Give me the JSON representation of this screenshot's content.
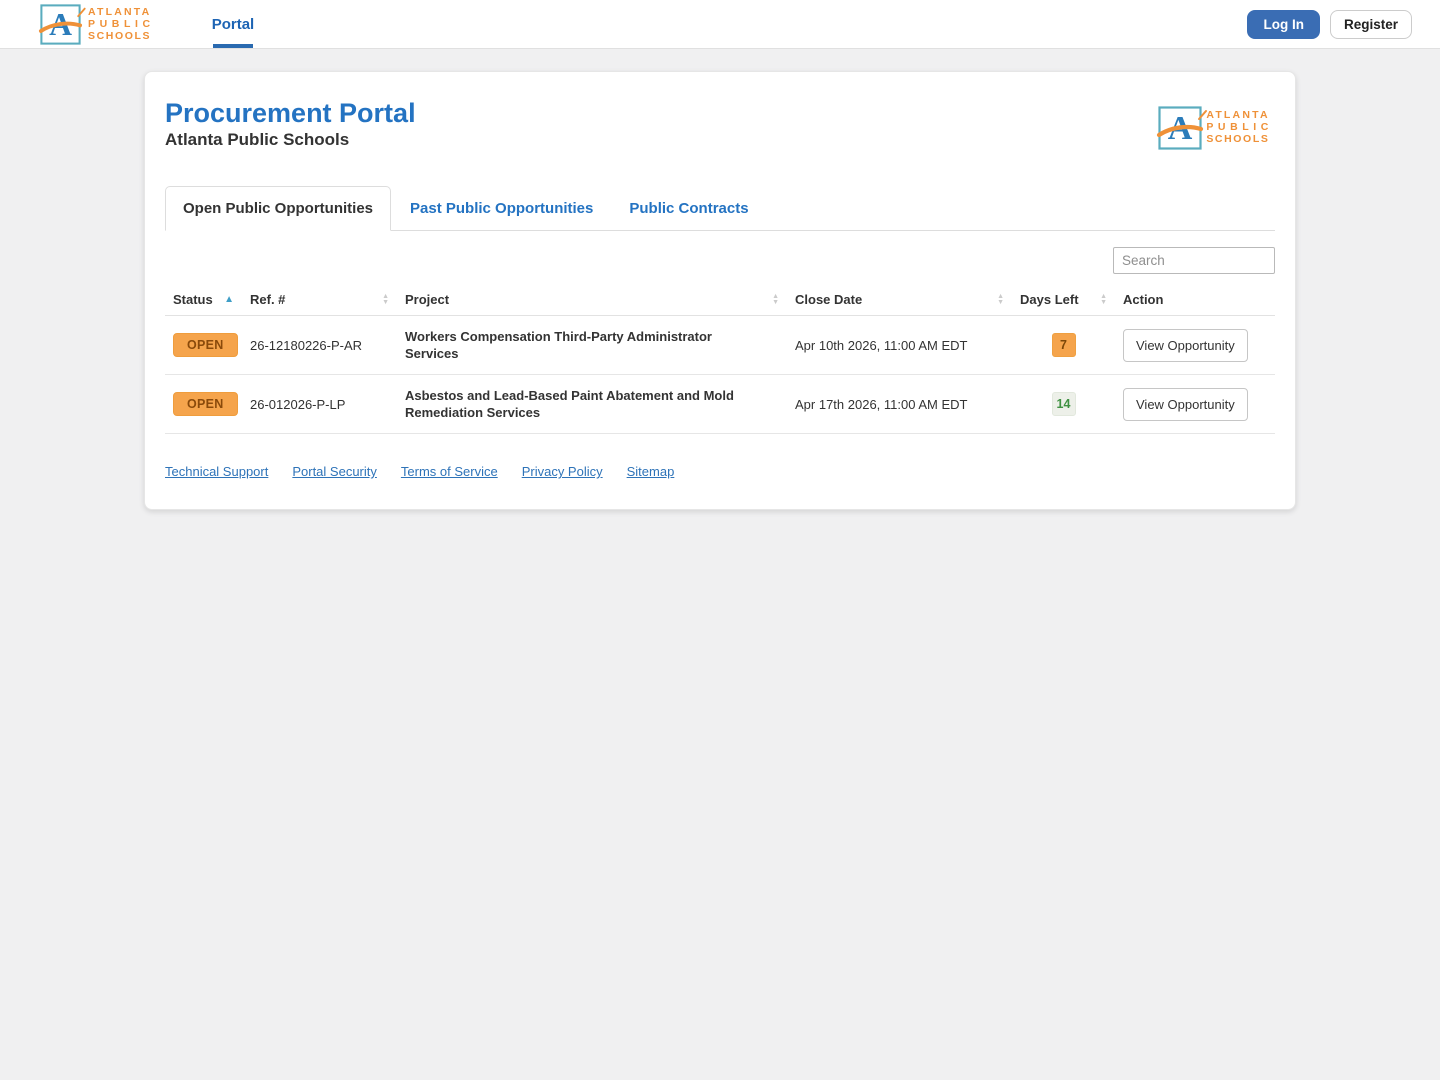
{
  "brand": {
    "letter": "A",
    "line1": "ATLANTA",
    "line2": "PUBLIC",
    "line3": "SCHOOLS"
  },
  "navbar": {
    "portal_link": "Portal",
    "login_label": "Log In",
    "register_label": "Register"
  },
  "header": {
    "title": "Procurement Portal",
    "subtitle": "Atlanta Public Schools"
  },
  "tabs": [
    {
      "label": "Open Public Opportunities",
      "active": true
    },
    {
      "label": "Past Public Opportunities",
      "active": false
    },
    {
      "label": "Public Contracts",
      "active": false
    }
  ],
  "search": {
    "placeholder": "Search"
  },
  "table": {
    "columns": [
      {
        "label": "Status",
        "sort": "asc"
      },
      {
        "label": "Ref. #",
        "sort": "both"
      },
      {
        "label": "Project",
        "sort": "both"
      },
      {
        "label": "Close Date",
        "sort": "both"
      },
      {
        "label": "Days Left",
        "sort": "both"
      },
      {
        "label": "Action",
        "sort": "none"
      }
    ],
    "rows": [
      {
        "status": "OPEN",
        "ref": "26-12180226-P-AR",
        "project": "Workers Compensation Third-Party Administrator Services",
        "close_date": "Apr 10th 2026, 11:00 AM EDT",
        "days_left": "7",
        "days_left_style": "orange",
        "action": "View Opportunity"
      },
      {
        "status": "OPEN",
        "ref": "26-012026-P-LP",
        "project": "Asbestos and Lead-Based Paint Abatement and Mold Remediation Services",
        "close_date": "Apr 17th 2026, 11:00 AM EDT",
        "days_left": "14",
        "days_left_style": "green",
        "action": "View Opportunity"
      }
    ]
  },
  "footer": {
    "links": [
      "Technical Support",
      "Portal Security",
      "Terms of Service",
      "Privacy Policy",
      "Sitemap"
    ]
  },
  "colors": {
    "accent_blue": "#2473c2",
    "button_blue": "#3a6db4",
    "badge_orange_bg": "#f5a44c",
    "badge_orange_text": "#8a4a0b",
    "badge_green_bg": "#edf0e9",
    "badge_green_text": "#3f9142",
    "brand_orange": "#ef9138",
    "brand_teal": "#5aacbe",
    "brand_letter_blue": "#2b7cba"
  }
}
